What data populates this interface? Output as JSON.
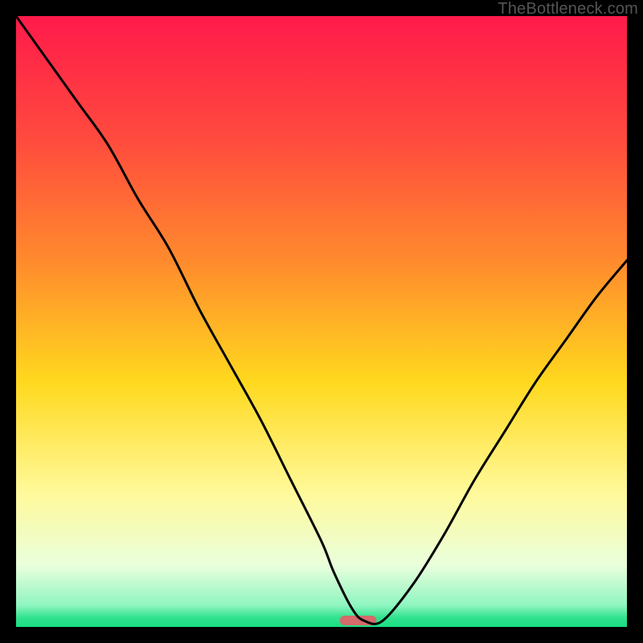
{
  "attribution": "TheBottleneck.com",
  "chart_data": {
    "type": "line",
    "title": "",
    "xlabel": "",
    "ylabel": "",
    "xlim": [
      0,
      100
    ],
    "ylim": [
      0,
      100
    ],
    "background_gradient": {
      "stops": [
        {
          "pos": 0.0,
          "color": "#ff1a4b"
        },
        {
          "pos": 0.2,
          "color": "#ff4a3e"
        },
        {
          "pos": 0.4,
          "color": "#ff8a2d"
        },
        {
          "pos": 0.6,
          "color": "#ffd91e"
        },
        {
          "pos": 0.78,
          "color": "#fff99a"
        },
        {
          "pos": 0.9,
          "color": "#e9ffdc"
        },
        {
          "pos": 0.965,
          "color": "#8ef5c0"
        },
        {
          "pos": 0.985,
          "color": "#2fe28d"
        },
        {
          "pos": 1.0,
          "color": "#1adf83"
        }
      ]
    },
    "series": [
      {
        "name": "bottleneck-curve",
        "x": [
          0,
          5,
          10,
          15,
          20,
          25,
          30,
          35,
          40,
          45,
          50,
          52,
          55,
          57,
          60,
          65,
          70,
          75,
          80,
          85,
          90,
          95,
          100
        ],
        "y": [
          100,
          93,
          86,
          79,
          70,
          62,
          52,
          43,
          34,
          24,
          14,
          9,
          3,
          1,
          1,
          7,
          15,
          24,
          32,
          40,
          47,
          54,
          60
        ]
      }
    ],
    "marker": {
      "name": "optimal-zone",
      "x_center": 56,
      "width": 6,
      "color": "#d46a6a"
    }
  }
}
